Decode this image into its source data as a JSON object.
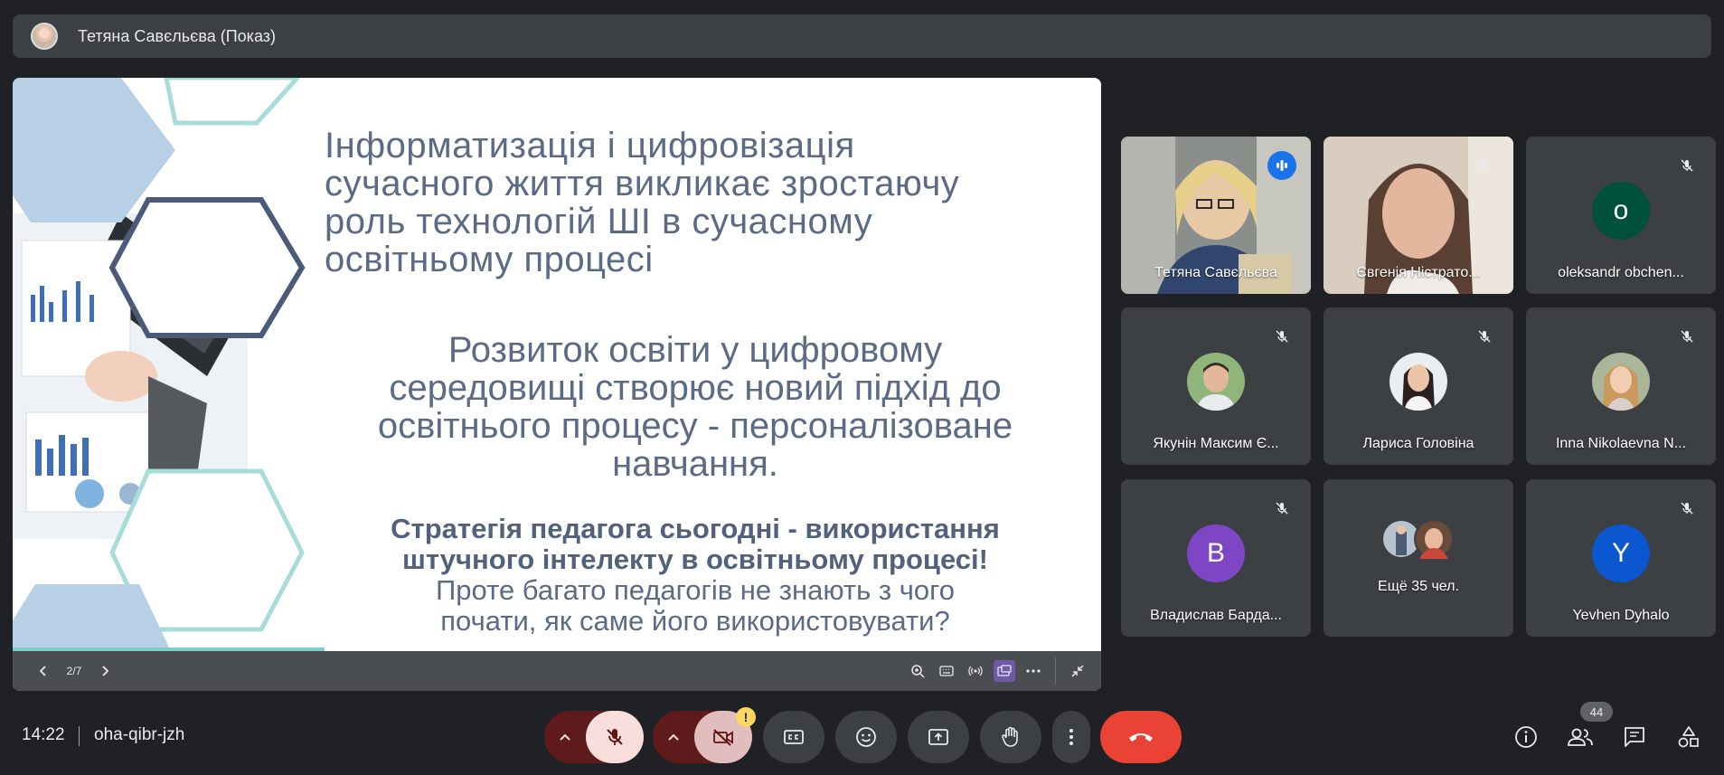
{
  "presenter_bar": {
    "title": "Тетяна Савєльєва (Показ)",
    "avatar_icon": "presenter-avatar"
  },
  "slide": {
    "title": "Інформатизація і цифровізація сучасного життя викликає зростаючу роль технологій ШІ в сучасному освітньому процесі",
    "title_lines": [
      "Інформатизація і цифровізація",
      "сучасного життя викликає зростаючу",
      "роль технологій ШІ в сучасному",
      "освітньому процесі"
    ],
    "subtitle_lines": [
      "Розвиток освіти у цифровому",
      "середовищі створює новий підхід до",
      "освітнього процесу - персоналізоване",
      "навчання."
    ],
    "bold_lines": [
      "Стратегія педагога сьогодні - використання",
      "штучного інтелекту в освітньому процесі!"
    ],
    "plain_lines": [
      "Проте багато педагогів не знають з чого",
      "почати, як саме його використовувати?"
    ],
    "page_indicator": "2/7"
  },
  "participants": [
    {
      "name": "Тетяна Савєльєва",
      "state": "speaking",
      "kind": "video"
    },
    {
      "name": "Євгенія Ністрато...",
      "state": "muted",
      "kind": "video"
    },
    {
      "name": "oleksandr obchen...",
      "state": "muted",
      "kind": "letter",
      "letter": "o",
      "color": "#00513a"
    },
    {
      "name": "Якунін Максим Є...",
      "state": "muted",
      "kind": "photo"
    },
    {
      "name": "Лариса Головіна",
      "state": "muted",
      "kind": "photo"
    },
    {
      "name": "Inna Nikolaevna N...",
      "state": "muted",
      "kind": "photo"
    },
    {
      "name": "Владислав Барда...",
      "state": "muted",
      "kind": "letter",
      "letter": "B",
      "color": "#7e45c4"
    },
    {
      "name": "Ещё 35 чел.",
      "state": "group",
      "kind": "group"
    },
    {
      "name": "Yevhen Dyhalo",
      "state": "muted",
      "kind": "letter",
      "letter": "Y",
      "color": "#0b57d0"
    }
  ],
  "footer": {
    "time": "14:22",
    "meeting_code": "oha-qibr-jzh",
    "people_count": "44",
    "camera_warning": "!"
  },
  "colors": {
    "background": "#202124",
    "tile": "#3c4043",
    "end_call": "#ea4335",
    "speaking": "#1a73e8",
    "mic_off_pill": "#f9dedc"
  }
}
